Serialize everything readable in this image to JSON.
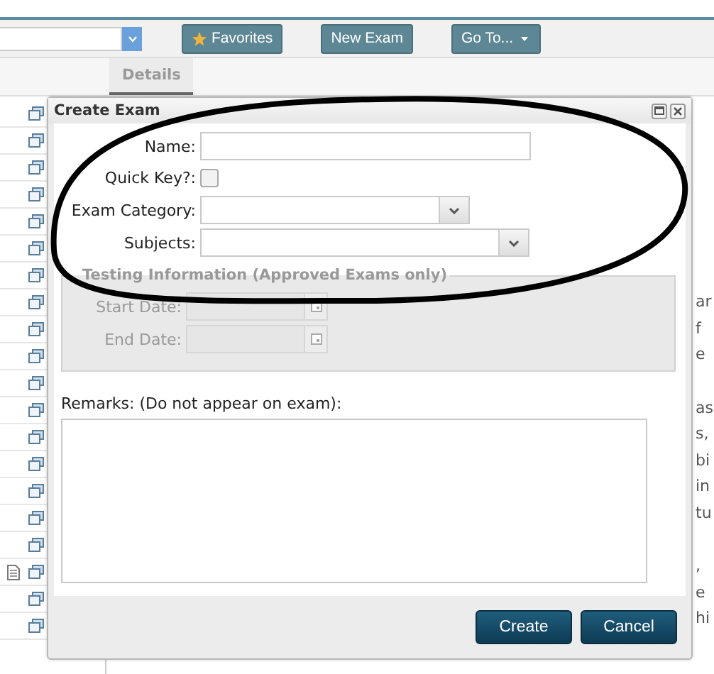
{
  "toolbar": {
    "buttons": [
      {
        "label": "Favorites",
        "kind": "star"
      },
      {
        "label": "New Exam",
        "kind": "plain"
      },
      {
        "label": "Go To...",
        "kind": "menu"
      }
    ]
  },
  "tabs": [
    {
      "label": "Details",
      "selected": true
    }
  ],
  "background_text": [
    [
      "ar",
      "f",
      "e"
    ],
    [
      "as",
      "s,",
      "bi",
      "in",
      "tu"
    ],
    [
      ",",
      "e",
      "hi"
    ]
  ],
  "dialog": {
    "title": "Create Exam",
    "fields": [
      {
        "kind": "text",
        "label": "Name:"
      },
      {
        "kind": "checkbox",
        "label": "Quick Key?:",
        "checked": false
      },
      {
        "kind": "select",
        "label": "Exam Category:"
      },
      {
        "kind": "select",
        "label": "Subjects:"
      }
    ],
    "testing": {
      "legend": "Testing Information (Approved Exams only)",
      "disabled": true,
      "fields": [
        {
          "label": "Start Date:"
        },
        {
          "label": "End Date:"
        }
      ]
    },
    "remarks": {
      "label": "Remarks: (Do not appear on exam):"
    },
    "buttons": [
      {
        "label": "Create"
      },
      {
        "label": "Cancel"
      }
    ]
  }
}
